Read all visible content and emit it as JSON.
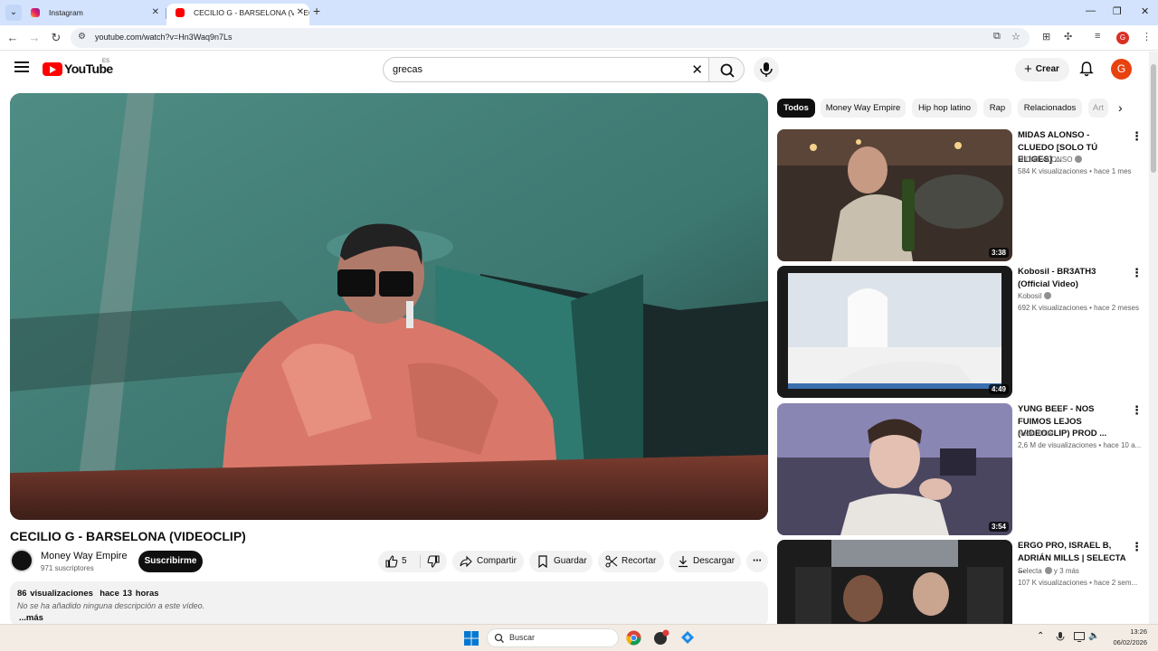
{
  "browser": {
    "tabs": [
      {
        "title": "Instagram",
        "active": false
      },
      {
        "title": "CECILIO G - BARSELONA (VIDEO",
        "active": true
      }
    ],
    "url": "youtube.com/watch?v=Hn3Waq9n7Ls",
    "profile_initial": "G"
  },
  "youtube": {
    "logo_text": "YouTube",
    "country_code": "ES",
    "search_query": "grecas",
    "create_label": "Crear",
    "avatar_initial": "G"
  },
  "video": {
    "title": "CECILIO G - BARSELONA (VIDEOCLIP)",
    "channel": "Money Way Empire",
    "subscribers": "971 suscriptores",
    "subscribe_label": "Suscribirme",
    "likes": "5",
    "share_label": "Compartir",
    "save_label": "Guardar",
    "clip_label": "Recortar",
    "download_label": "Descargar",
    "views": "86 visualizaciones",
    "posted": "hace 13 horas",
    "description": "No se ha añadido ninguna descripción a este vídeo.",
    "more_label": "...más"
  },
  "chips": [
    "Todos",
    "Money Way Empire",
    "Hip hop latino",
    "Rap",
    "Relacionados",
    "Art"
  ],
  "recommendations": [
    {
      "title": "MIDAS ALONSO - CLUEDO [SOLO TÚ ELIGES] ...",
      "channel": "MIDAS ALONSO",
      "verified": true,
      "meta": "584 K visualizaciones • hace 1 mes",
      "duration": "3:38"
    },
    {
      "title": "Kobosil - BR3ATH3 (Official Video)",
      "channel": "Kobosil",
      "verified": true,
      "meta": "692 K visualizaciones • hace 2 meses",
      "duration": "4:49"
    },
    {
      "title": "YUNG BEEF - NOS FUIMOS LEJOS (VIDEOCLIP) PROD ...",
      "channel": "Neon Knife",
      "verified": false,
      "meta": "2,6 M de visualizaciones • hace 10 a...",
      "duration": "3:54"
    },
    {
      "title": "ERGO PRO, ISRAEL B, ADRIÁN MILLS | SELECTA ...",
      "channel": "Selecta",
      "verified": true,
      "channel_suffix": "y 3 más",
      "meta": "107 K visualizaciones • hace 2 sem...",
      "duration": ""
    }
  ],
  "taskbar": {
    "search_placeholder": "Buscar",
    "time": "13:26",
    "date": "06/02/2026"
  }
}
